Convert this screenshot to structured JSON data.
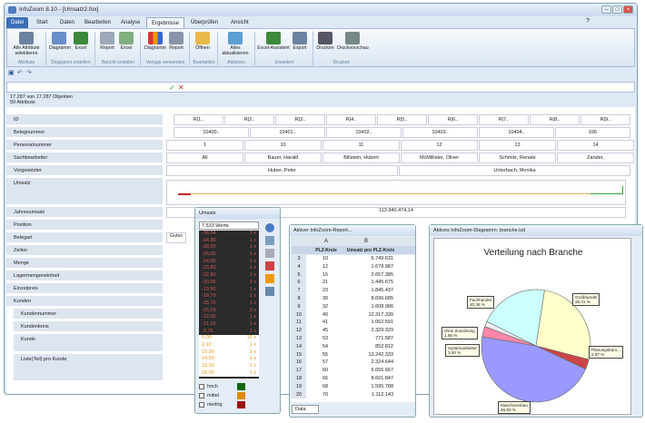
{
  "window": {
    "title": "InfoZoom 8.10 - [Umsatz2.fox]"
  },
  "tabs": [
    "Datei",
    "Start",
    "Daten",
    "Bearbeiten",
    "Analyse",
    "Ergebnisse",
    "Überprüfen",
    "Ansicht"
  ],
  "ribbon": {
    "buttons": [
      {
        "label": "Alle Attribute selektieren",
        "icon": "list-icon"
      },
      {
        "label": "Diagramm",
        "icon": "chart-icon"
      },
      {
        "label": "Excel",
        "icon": "excel-icon"
      },
      {
        "label": "Report",
        "icon": "report-icon"
      },
      {
        "label": "Excel",
        "icon": "excel-icon"
      },
      {
        "label": "Diagramm",
        "icon": "bar-chart-icon"
      },
      {
        "label": "Report",
        "icon": "report-icon"
      },
      {
        "label": "Öffnen",
        "icon": "folder-icon"
      },
      {
        "label": "Alles aktualisieren",
        "icon": "refresh-icon"
      },
      {
        "label": "Excel-Assistent",
        "icon": "excel-icon"
      },
      {
        "label": "Export",
        "icon": "export-icon"
      },
      {
        "label": "Drucken",
        "icon": "printer-icon"
      },
      {
        "label": "Druckvorschau",
        "icon": "preview-icon"
      }
    ],
    "groups": [
      "Attribute",
      "Diagramm erstellen",
      "Bericht erstellen",
      "Vorlage verwenden",
      "Bearbeiten",
      "Aktionen",
      "Erweitert",
      "Drucken"
    ]
  },
  "status": {
    "objects": "17.287 von 17.287 Objekten",
    "attributes": "59 Attribute"
  },
  "rows": [
    {
      "label": "ID"
    },
    {
      "label": "Belegnummer"
    },
    {
      "label": "Personalnummer"
    },
    {
      "label": "Sachbearbeiter"
    },
    {
      "label": "Vorgesetzter"
    },
    {
      "label": "Umsatz"
    },
    {
      "label": "Jahresumsatz"
    },
    {
      "label": "Position"
    },
    {
      "label": "Belegart"
    },
    {
      "label": "Zeilen"
    },
    {
      "label": "Menge"
    },
    {
      "label": "Lagermengeneinheit"
    },
    {
      "label": "Einzelpreis"
    },
    {
      "label": "Kunden"
    },
    {
      "label": "Kundennummer"
    },
    {
      "label": "Kundenkreis"
    },
    {
      "label": "Kunde"
    },
    {
      "label": "Liste(Teil) pro Kunde"
    }
  ],
  "cells": {
    "id": [
      "R|1..",
      "R|2..",
      "R|3..",
      "R|4..",
      "R|5..",
      "R|6..",
      "R|7..",
      "R|8..",
      "R|9.."
    ],
    "beleg": [
      "10400..",
      "10401..",
      "10402..",
      "10403..",
      "10404..",
      "106"
    ],
    "personal": [
      "1",
      "10",
      "11",
      "12",
      "13",
      "14"
    ],
    "sach": [
      "All",
      "Bauer, Harald",
      "Billstein, Hubert",
      "McMillister, Oliver",
      "Schmitz, Renate",
      "Zander,"
    ],
    "vorg": [
      "Huber, Peter",
      "Unterbach, Monika"
    ],
    "jahres": "113.940.474,14",
    "beleg_art": "Gutsc"
  },
  "umsatz_popup": {
    "title": "Umsatz",
    "header": "7.533 Werte",
    "values": [
      [
        "-36,54",
        "1 x"
      ],
      [
        "-34,80",
        "1 x"
      ],
      [
        "-30,00",
        "1 x"
      ],
      [
        "-26,00",
        "1 x"
      ],
      [
        "-24,00",
        "1 x"
      ],
      [
        "-23,80",
        "1 x"
      ],
      [
        "-22,80",
        "1 x"
      ],
      [
        "-20,00",
        "2 x"
      ],
      [
        "-19,50",
        "1 x"
      ],
      [
        "-18,79",
        "1 x"
      ],
      [
        "-15,70",
        "1 x"
      ],
      [
        "-15,03",
        "2 x"
      ],
      [
        "-12,00",
        "1 x"
      ],
      [
        "-11,19",
        "1 x"
      ],
      [
        "-3,75",
        "1 x"
      ],
      [
        "0,00",
        "12 x"
      ],
      [
        "2,10",
        "1 x"
      ],
      [
        "10,00",
        "1 x"
      ],
      [
        "14,50",
        "1 x"
      ],
      [
        "15,00",
        "2 x"
      ],
      [
        "18,00",
        "1 x"
      ]
    ],
    "levels": [
      {
        "label": "hoch",
        "color": "#0f6a0f"
      },
      {
        "label": "mittel",
        "color": "#e08a10"
      },
      {
        "label": "niedrig",
        "color": "#9a1010"
      }
    ]
  },
  "report": {
    "title": "Aktiver InfoZoom-Report...",
    "colA": "A",
    "colB": "B",
    "header1": "PLZ-Kreis",
    "header2": "Umsatz pro PLZ-Kreis",
    "rows": [
      [
        "3",
        "10",
        "6.749.631"
      ],
      [
        "4",
        "12",
        "1.678.987"
      ],
      [
        "5",
        "15",
        "2.657.385"
      ],
      [
        "6",
        "21",
        "1.445.675"
      ],
      [
        "7",
        "23",
        "1.845.437"
      ],
      [
        "8",
        "30",
        "8.696.685"
      ],
      [
        "9",
        "32",
        "1.608.986"
      ],
      [
        "10",
        "40",
        "12.317.339"
      ],
      [
        "11",
        "41",
        "1.062.591"
      ],
      [
        "12",
        "45",
        "2.329.329"
      ],
      [
        "13",
        "53",
        "771.587"
      ],
      [
        "14",
        "54",
        "852.812"
      ],
      [
        "15",
        "55",
        "13.242.333"
      ],
      [
        "16",
        "57",
        "2.324.644"
      ],
      [
        "17",
        "60",
        "6.655.667"
      ],
      [
        "18",
        "66",
        "8.601.847"
      ],
      [
        "19",
        "68",
        "1.595.788"
      ],
      [
        "20",
        "70",
        "1.112.143"
      ]
    ],
    "sheet": "Data"
  },
  "diagram": {
    "title": "Aktives InfoZoom-Diagramm: branche.izd"
  },
  "chart_data": {
    "type": "pie",
    "title": "Verteilung nach Branche",
    "slices": [
      {
        "label": "Großhandel",
        "value": 26.41,
        "display": "26,41 %",
        "color": "#ffffcc"
      },
      {
        "label": "Planungsbüro...",
        "value": 2.87,
        "display": "2,87 %",
        "color": "#cc4444"
      },
      {
        "label": "Maschinenbau",
        "value": 45.8,
        "display": "45,80 %",
        "color": "#9999ff"
      },
      {
        "label": "Systemanbieter",
        "value": 3.0,
        "display": "3,00 %",
        "color": "#ff88aa"
      },
      {
        "label": "ohne Zuordnung",
        "value": 1.55,
        "display": "1,55 %",
        "color": "#eeeeee"
      },
      {
        "label": "Fachhandel",
        "value": 20.36,
        "display": "20,36 %",
        "color": "#ccffff"
      }
    ]
  }
}
